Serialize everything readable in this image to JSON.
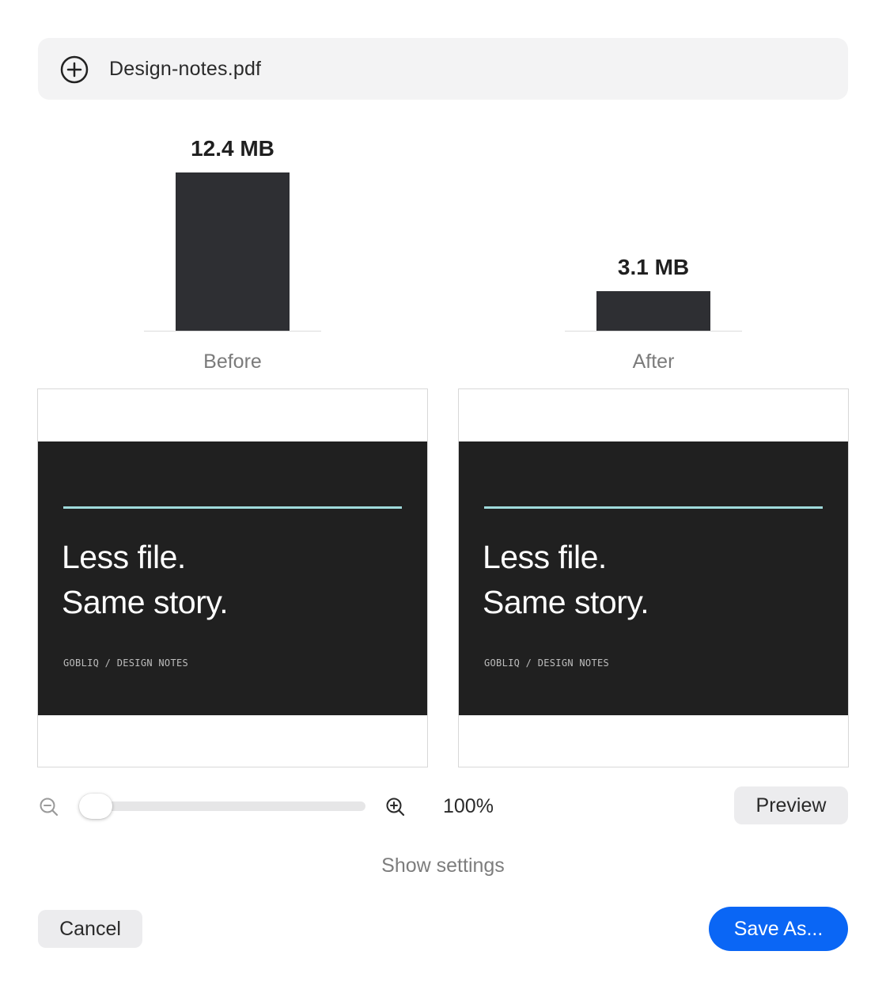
{
  "file": {
    "name": "Design-notes.pdf",
    "icon": "plus-circle-icon"
  },
  "chart_data": {
    "type": "bar",
    "categories": [
      "Before",
      "After"
    ],
    "values": [
      12.4,
      3.1
    ],
    "value_labels": [
      "12.4 MB",
      "3.1 MB"
    ],
    "unit": "MB",
    "title": "",
    "xlabel": "",
    "ylabel": "",
    "colors": {
      "bar": "#2e2f33"
    }
  },
  "previews": [
    {
      "title_line1": "Less file.",
      "title_line2": "Same story.",
      "caption": "GOBLIQ / DESIGN NOTES"
    },
    {
      "title_line1": "Less file.",
      "title_line2": "Same story.",
      "caption": "GOBLIQ / DESIGN NOTES"
    }
  ],
  "zoom": {
    "value_label": "100%",
    "level": 0.0,
    "out_icon": "zoom-out-icon",
    "in_icon": "zoom-in-icon"
  },
  "buttons": {
    "preview": "Preview",
    "show_settings": "Show settings",
    "cancel": "Cancel",
    "save_as": "Save As..."
  },
  "colors": {
    "accent": "#0a66f5",
    "slide_background": "#202020",
    "slide_rule": "#9fdadb"
  }
}
